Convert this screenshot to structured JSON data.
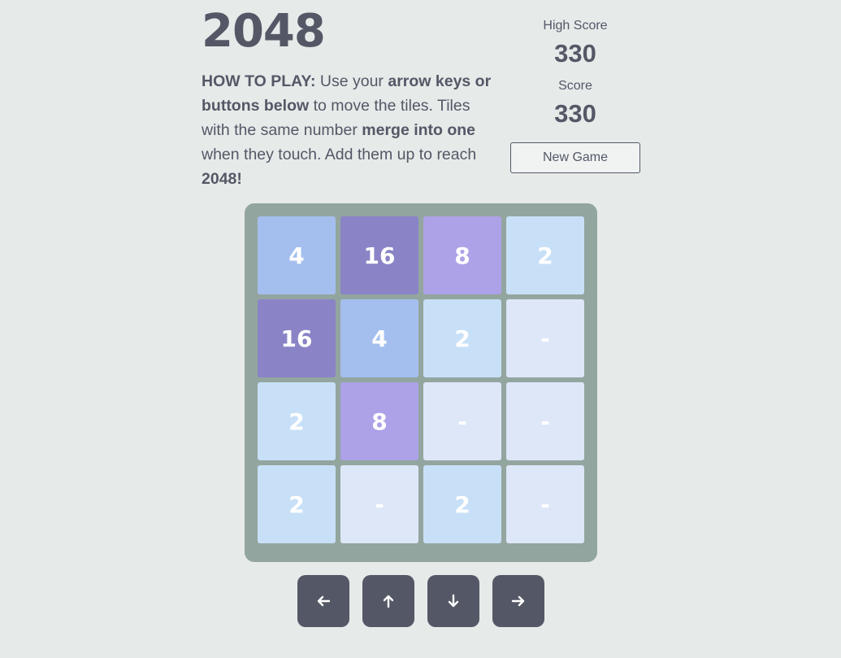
{
  "header": {
    "title": "2048"
  },
  "instructions": {
    "lead": "HOW TO PLAY:",
    "t1": " Use your ",
    "b1": "arrow keys or buttons below",
    "t2": " to move the tiles. Tiles with the same number ",
    "b2": "merge into one",
    "t3": " when they touch. Add them up to reach ",
    "b3": "2048!"
  },
  "scores": {
    "high_label": "High Score",
    "high_value": "330",
    "score_label": "Score",
    "score_value": "330"
  },
  "new_game_label": "New Game",
  "board": {
    "rows": [
      [
        "4",
        "16",
        "8",
        "2"
      ],
      [
        "16",
        "4",
        "2",
        "-"
      ],
      [
        "2",
        "8",
        "-",
        "-"
      ],
      [
        "2",
        "-",
        "2",
        "-"
      ]
    ]
  },
  "tile_colors": {
    "-": "#dde7f8",
    "2": "#c8e0f7",
    "4": "#a4bfee",
    "8": "#ada2e8",
    "16": "#8a84c7"
  },
  "controls": [
    {
      "name": "left-arrow-button",
      "icon": "arrow-left-icon"
    },
    {
      "name": "up-arrow-button",
      "icon": "arrow-up-icon"
    },
    {
      "name": "down-arrow-button",
      "icon": "arrow-down-icon"
    },
    {
      "name": "right-arrow-button",
      "icon": "arrow-right-icon"
    }
  ]
}
